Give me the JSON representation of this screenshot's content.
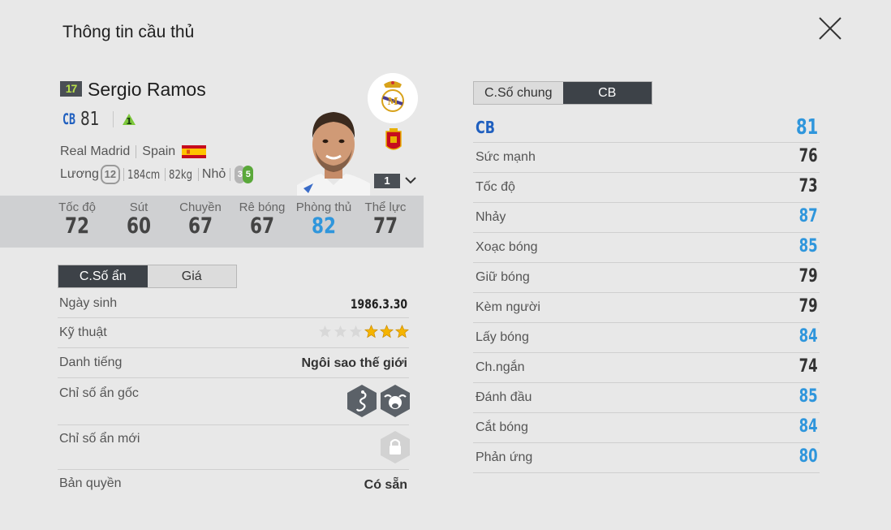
{
  "title": "Thông tin cầu thủ",
  "player": {
    "season": "17",
    "name": "Sergio Ramos",
    "position": "CB",
    "ovr": "81",
    "upgrade": "1",
    "club": "Real Madrid",
    "nation": "Spain",
    "salary_label": "Lương",
    "salary": "12",
    "height": "184cm",
    "weight": "82kg",
    "build": "Nhỏ",
    "foot_left": "3",
    "foot_right": "5",
    "level": "1"
  },
  "main_stats": [
    {
      "label": "Tốc độ",
      "value": "72",
      "highlight": false
    },
    {
      "label": "Sút",
      "value": "60",
      "highlight": false
    },
    {
      "label": "Chuyền",
      "value": "67",
      "highlight": false
    },
    {
      "label": "Rê bóng",
      "value": "67",
      "highlight": false
    },
    {
      "label": "Phòng thủ",
      "value": "82",
      "highlight": true
    },
    {
      "label": "Thể lực",
      "value": "77",
      "highlight": false
    }
  ],
  "left_tabs": {
    "hidden": "C.Số ẩn",
    "price": "Giá"
  },
  "details": {
    "dob_label": "Ngày sinh",
    "dob": "1986.3.30",
    "skill_label": "Kỹ thuật",
    "skill_stars": 3,
    "skill_max": 6,
    "fame_label": "Danh tiếng",
    "fame": "Ngôi sao thế giới",
    "orig_traits_label": "Chỉ số ẩn gốc",
    "new_traits_label": "Chỉ số ẩn mới",
    "license_label": "Bản quyền",
    "license": "Có sẵn"
  },
  "right_tabs": {
    "general": "C.Số chung",
    "cb": "CB"
  },
  "position_stats": {
    "head": {
      "label": "CB",
      "value": "81"
    },
    "rows": [
      {
        "label": "Sức mạnh",
        "value": "76",
        "highlight": false
      },
      {
        "label": "Tốc độ",
        "value": "73",
        "highlight": false
      },
      {
        "label": "Nhảy",
        "value": "87",
        "highlight": true
      },
      {
        "label": "Xoạc bóng",
        "value": "85",
        "highlight": true
      },
      {
        "label": "Giữ bóng",
        "value": "79",
        "highlight": false
      },
      {
        "label": "Kèm người",
        "value": "79",
        "highlight": false
      },
      {
        "label": "Lấy bóng",
        "value": "84",
        "highlight": true
      },
      {
        "label": "Ch.ngắn",
        "value": "74",
        "highlight": false
      },
      {
        "label": "Đánh đầu",
        "value": "85",
        "highlight": true
      },
      {
        "label": "Cắt bóng",
        "value": "84",
        "highlight": true
      },
      {
        "label": "Phản ứng",
        "value": "80",
        "highlight": true
      }
    ]
  },
  "colors": {
    "accent_blue": "#2f96dc",
    "position_blue": "#1f5fbf",
    "dark_tab": "#3d4248",
    "star_gold": "#f5b400"
  }
}
